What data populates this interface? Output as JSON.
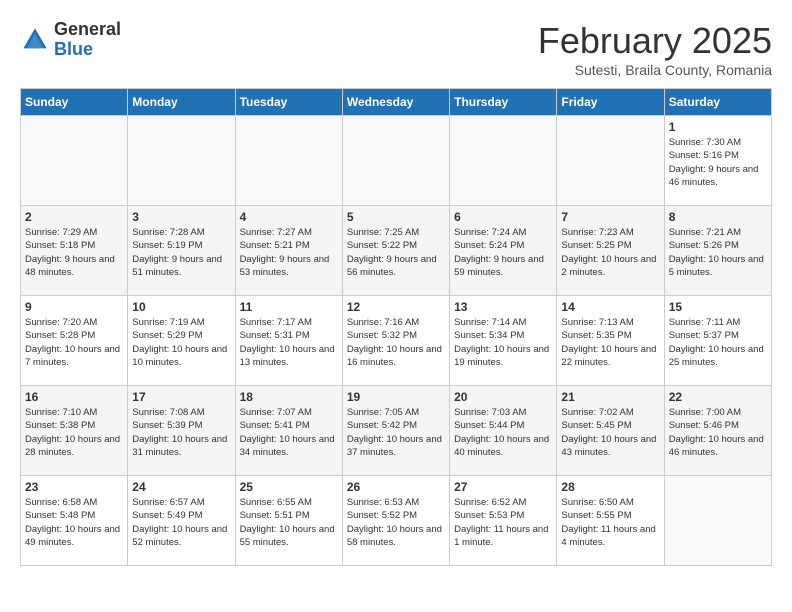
{
  "header": {
    "logo_general": "General",
    "logo_blue": "Blue",
    "month_title": "February 2025",
    "subtitle": "Sutesti, Braila County, Romania"
  },
  "days_of_week": [
    "Sunday",
    "Monday",
    "Tuesday",
    "Wednesday",
    "Thursday",
    "Friday",
    "Saturday"
  ],
  "weeks": [
    [
      {
        "day": "",
        "info": ""
      },
      {
        "day": "",
        "info": ""
      },
      {
        "day": "",
        "info": ""
      },
      {
        "day": "",
        "info": ""
      },
      {
        "day": "",
        "info": ""
      },
      {
        "day": "",
        "info": ""
      },
      {
        "day": "1",
        "info": "Sunrise: 7:30 AM\nSunset: 5:16 PM\nDaylight: 9 hours\nand 46 minutes."
      }
    ],
    [
      {
        "day": "2",
        "info": "Sunrise: 7:29 AM\nSunset: 5:18 PM\nDaylight: 9 hours\nand 48 minutes."
      },
      {
        "day": "3",
        "info": "Sunrise: 7:28 AM\nSunset: 5:19 PM\nDaylight: 9 hours\nand 51 minutes."
      },
      {
        "day": "4",
        "info": "Sunrise: 7:27 AM\nSunset: 5:21 PM\nDaylight: 9 hours\nand 53 minutes."
      },
      {
        "day": "5",
        "info": "Sunrise: 7:25 AM\nSunset: 5:22 PM\nDaylight: 9 hours\nand 56 minutes."
      },
      {
        "day": "6",
        "info": "Sunrise: 7:24 AM\nSunset: 5:24 PM\nDaylight: 9 hours\nand 59 minutes."
      },
      {
        "day": "7",
        "info": "Sunrise: 7:23 AM\nSunset: 5:25 PM\nDaylight: 10 hours\nand 2 minutes."
      },
      {
        "day": "8",
        "info": "Sunrise: 7:21 AM\nSunset: 5:26 PM\nDaylight: 10 hours\nand 5 minutes."
      }
    ],
    [
      {
        "day": "9",
        "info": "Sunrise: 7:20 AM\nSunset: 5:28 PM\nDaylight: 10 hours\nand 7 minutes."
      },
      {
        "day": "10",
        "info": "Sunrise: 7:19 AM\nSunset: 5:29 PM\nDaylight: 10 hours\nand 10 minutes."
      },
      {
        "day": "11",
        "info": "Sunrise: 7:17 AM\nSunset: 5:31 PM\nDaylight: 10 hours\nand 13 minutes."
      },
      {
        "day": "12",
        "info": "Sunrise: 7:16 AM\nSunset: 5:32 PM\nDaylight: 10 hours\nand 16 minutes."
      },
      {
        "day": "13",
        "info": "Sunrise: 7:14 AM\nSunset: 5:34 PM\nDaylight: 10 hours\nand 19 minutes."
      },
      {
        "day": "14",
        "info": "Sunrise: 7:13 AM\nSunset: 5:35 PM\nDaylight: 10 hours\nand 22 minutes."
      },
      {
        "day": "15",
        "info": "Sunrise: 7:11 AM\nSunset: 5:37 PM\nDaylight: 10 hours\nand 25 minutes."
      }
    ],
    [
      {
        "day": "16",
        "info": "Sunrise: 7:10 AM\nSunset: 5:38 PM\nDaylight: 10 hours\nand 28 minutes."
      },
      {
        "day": "17",
        "info": "Sunrise: 7:08 AM\nSunset: 5:39 PM\nDaylight: 10 hours\nand 31 minutes."
      },
      {
        "day": "18",
        "info": "Sunrise: 7:07 AM\nSunset: 5:41 PM\nDaylight: 10 hours\nand 34 minutes."
      },
      {
        "day": "19",
        "info": "Sunrise: 7:05 AM\nSunset: 5:42 PM\nDaylight: 10 hours\nand 37 minutes."
      },
      {
        "day": "20",
        "info": "Sunrise: 7:03 AM\nSunset: 5:44 PM\nDaylight: 10 hours\nand 40 minutes."
      },
      {
        "day": "21",
        "info": "Sunrise: 7:02 AM\nSunset: 5:45 PM\nDaylight: 10 hours\nand 43 minutes."
      },
      {
        "day": "22",
        "info": "Sunrise: 7:00 AM\nSunset: 5:46 PM\nDaylight: 10 hours\nand 46 minutes."
      }
    ],
    [
      {
        "day": "23",
        "info": "Sunrise: 6:58 AM\nSunset: 5:48 PM\nDaylight: 10 hours\nand 49 minutes."
      },
      {
        "day": "24",
        "info": "Sunrise: 6:57 AM\nSunset: 5:49 PM\nDaylight: 10 hours\nand 52 minutes."
      },
      {
        "day": "25",
        "info": "Sunrise: 6:55 AM\nSunset: 5:51 PM\nDaylight: 10 hours\nand 55 minutes."
      },
      {
        "day": "26",
        "info": "Sunrise: 6:53 AM\nSunset: 5:52 PM\nDaylight: 10 hours\nand 58 minutes."
      },
      {
        "day": "27",
        "info": "Sunrise: 6:52 AM\nSunset: 5:53 PM\nDaylight: 11 hours\nand 1 minute."
      },
      {
        "day": "28",
        "info": "Sunrise: 6:50 AM\nSunset: 5:55 PM\nDaylight: 11 hours\nand 4 minutes."
      },
      {
        "day": "",
        "info": ""
      }
    ]
  ]
}
